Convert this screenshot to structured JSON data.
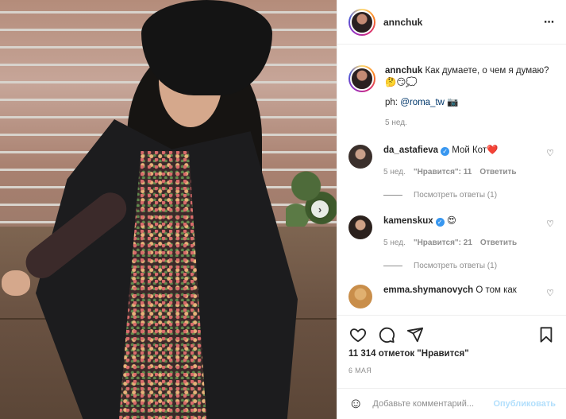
{
  "post": {
    "author": "annchuk",
    "more_icon": "⋯"
  },
  "caption": {
    "username": "annchuk",
    "text": "Как думаете, о чем я думаю? 🤔😏💭",
    "credit_prefix": "ph: ",
    "credit_mention": "@roma_tw",
    "credit_emoji": "📷",
    "time": "5 нед."
  },
  "comments": [
    {
      "username": "da_astafieva",
      "verified": true,
      "text": "Мой Кот❤️",
      "time": "5 нед.",
      "likes": "\"Нравится\": 11",
      "reply_label": "Ответить",
      "view_replies": "Посмотреть ответы (1)"
    },
    {
      "username": "kamenskux",
      "verified": true,
      "text": "😍",
      "time": "5 нед.",
      "likes": "\"Нравится\": 21",
      "reply_label": "Ответить",
      "view_replies": "Посмотреть ответы (1)"
    },
    {
      "username": "emma.shymanovych",
      "verified": false,
      "text": "О том как"
    }
  ],
  "likes_count": "11 314 отметок \"Нравится\"",
  "date": "6 МАЯ",
  "add_comment": {
    "placeholder": "Добавьте комментарий...",
    "publish_label": "Опубликовать"
  },
  "carousel": {
    "next_icon": "›"
  },
  "colors": {
    "link": "#00376b",
    "muted": "#8e8e8e",
    "verified": "#3897f0",
    "publish_disabled": "#b2dffc"
  },
  "icons": [
    "heart-icon",
    "comment-icon",
    "share-icon",
    "bookmark-icon",
    "emoji-icon",
    "more-icon",
    "next-icon"
  ]
}
